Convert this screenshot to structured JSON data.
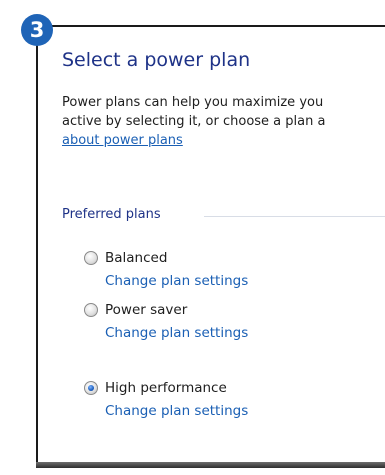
{
  "step_badge": "3",
  "page_title": "Select a power plan",
  "description": {
    "line1": "Power plans can help you maximize you",
    "line2": "active by selecting it, or choose a plan a"
  },
  "learn_more_link": "about power plans",
  "section": {
    "title": "Preferred plans"
  },
  "plans": [
    {
      "name": "Balanced",
      "change_link": "Change plan settings",
      "selected": false
    },
    {
      "name": "Power saver",
      "change_link": "Change plan settings",
      "selected": false
    },
    {
      "name": "High performance",
      "change_link": "Change plan settings",
      "selected": true
    }
  ],
  "colors": {
    "badge": "#1f64b7",
    "title": "#1e3287",
    "link": "#1a5fb4",
    "text": "#1e1e1e"
  }
}
